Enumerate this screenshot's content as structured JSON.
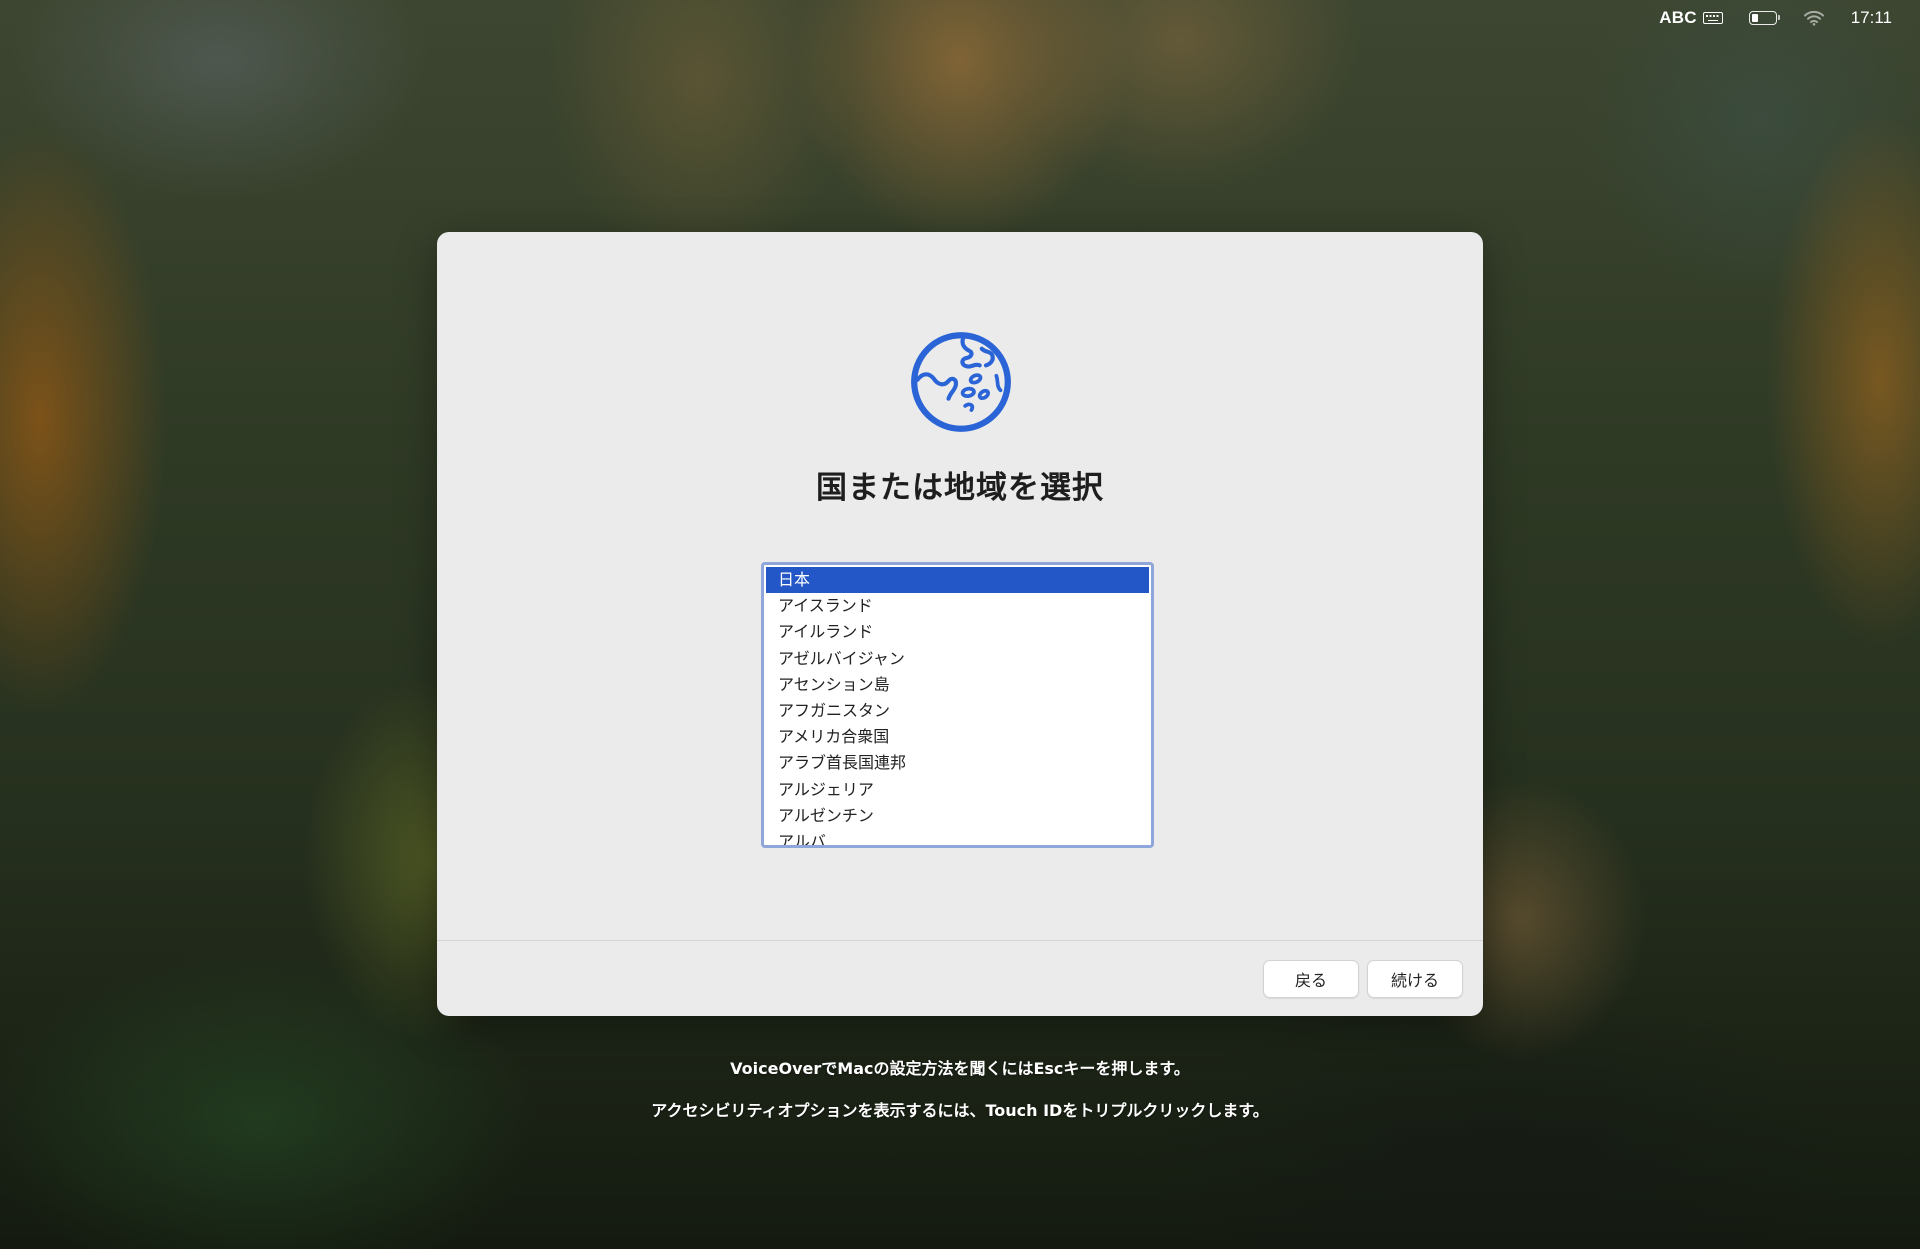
{
  "menubar": {
    "input_source": "ABC",
    "clock": "17:11",
    "battery_level": 0.3
  },
  "setup": {
    "icon": "globe-icon",
    "title": "国または地域を選択",
    "countries": [
      "日本",
      "アイスランド",
      "アイルランド",
      "アゼルバイジャン",
      "アセンション島",
      "アフガニスタン",
      "アメリカ合衆国",
      "アラブ首長国連邦",
      "アルジェリア",
      "アルゼンチン",
      "アルバ"
    ],
    "selected_country": "日本",
    "back_label": "戻る",
    "continue_label": "続ける"
  },
  "hints": {
    "voiceover": "VoiceOverでMacの設定方法を聞くにはEscキーを押します。",
    "accessibility": "アクセシビリティオプションを表示するには、Touch IDをトリプルクリックします。"
  },
  "colors": {
    "accent": "#2357c7",
    "icon_blue": "#2a64d6",
    "list_border": "#8fa6da"
  }
}
